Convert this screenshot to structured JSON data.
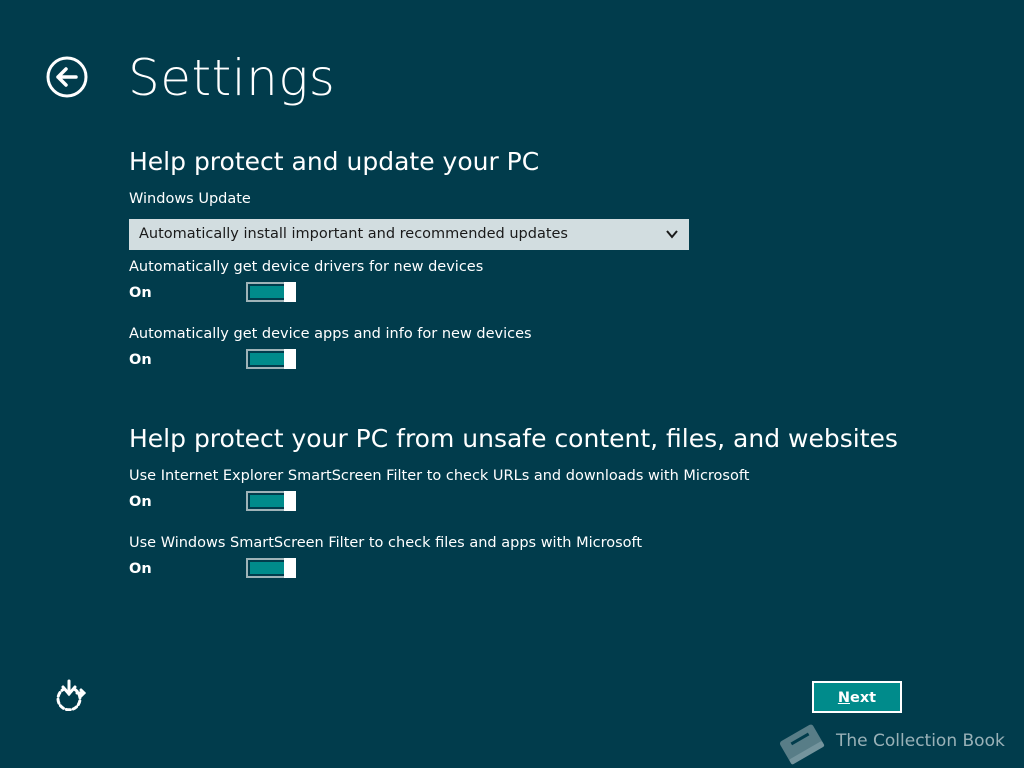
{
  "page": {
    "title": "Settings",
    "back_icon": "back-arrow-icon",
    "background_color": "#013c4c",
    "accent_color": "#008b8b"
  },
  "section_update": {
    "heading": "Help protect and update your PC",
    "windows_update": {
      "label": "Windows Update",
      "selected_value": "Automatically install important and recommended updates",
      "dropdown_icon": "chevron-down-icon"
    },
    "drivers": {
      "label": "Automatically get device drivers for new devices",
      "state": "On",
      "enabled": true
    },
    "apps_info": {
      "label": "Automatically get device apps and info for new devices",
      "state": "On",
      "enabled": true
    }
  },
  "section_protect": {
    "heading": "Help protect your PC from unsafe content, files, and websites",
    "ie_smartscreen": {
      "label": "Use Internet Explorer SmartScreen Filter to check URLs and downloads with Microsoft",
      "state": "On",
      "enabled": true
    },
    "windows_smartscreen": {
      "label": "Use Windows SmartScreen Filter to check files and apps with Microsoft",
      "state": "On",
      "enabled": true
    }
  },
  "footer": {
    "ease_of_access_icon": "ease-of-access-icon",
    "next_mnemonic": "N",
    "next_rest": "ext"
  },
  "watermark": {
    "icon": "book-icon",
    "text": "The Collection Book"
  }
}
